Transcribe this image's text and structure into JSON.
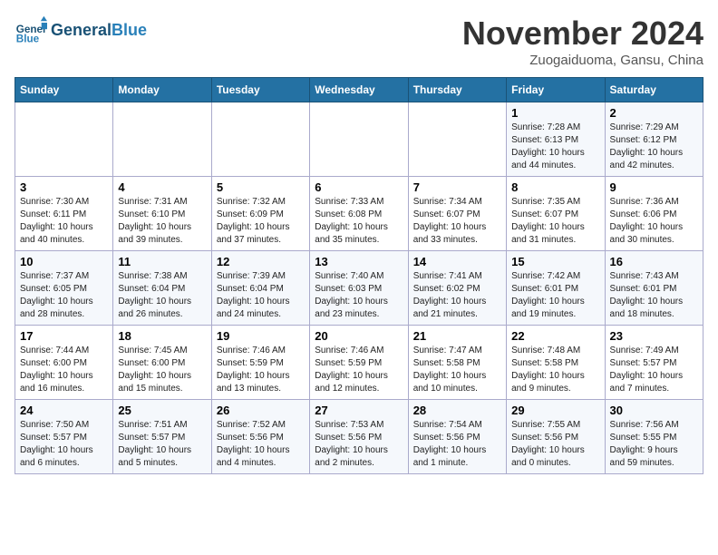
{
  "logo": {
    "line1": "General",
    "line2": "Blue"
  },
  "title": "November 2024",
  "location": "Zuogaiduoma, Gansu, China",
  "days_of_week": [
    "Sunday",
    "Monday",
    "Tuesday",
    "Wednesday",
    "Thursday",
    "Friday",
    "Saturday"
  ],
  "weeks": [
    [
      {
        "day": "",
        "info": ""
      },
      {
        "day": "",
        "info": ""
      },
      {
        "day": "",
        "info": ""
      },
      {
        "day": "",
        "info": ""
      },
      {
        "day": "",
        "info": ""
      },
      {
        "day": "1",
        "info": "Sunrise: 7:28 AM\nSunset: 6:13 PM\nDaylight: 10 hours\nand 44 minutes."
      },
      {
        "day": "2",
        "info": "Sunrise: 7:29 AM\nSunset: 6:12 PM\nDaylight: 10 hours\nand 42 minutes."
      }
    ],
    [
      {
        "day": "3",
        "info": "Sunrise: 7:30 AM\nSunset: 6:11 PM\nDaylight: 10 hours\nand 40 minutes."
      },
      {
        "day": "4",
        "info": "Sunrise: 7:31 AM\nSunset: 6:10 PM\nDaylight: 10 hours\nand 39 minutes."
      },
      {
        "day": "5",
        "info": "Sunrise: 7:32 AM\nSunset: 6:09 PM\nDaylight: 10 hours\nand 37 minutes."
      },
      {
        "day": "6",
        "info": "Sunrise: 7:33 AM\nSunset: 6:08 PM\nDaylight: 10 hours\nand 35 minutes."
      },
      {
        "day": "7",
        "info": "Sunrise: 7:34 AM\nSunset: 6:07 PM\nDaylight: 10 hours\nand 33 minutes."
      },
      {
        "day": "8",
        "info": "Sunrise: 7:35 AM\nSunset: 6:07 PM\nDaylight: 10 hours\nand 31 minutes."
      },
      {
        "day": "9",
        "info": "Sunrise: 7:36 AM\nSunset: 6:06 PM\nDaylight: 10 hours\nand 30 minutes."
      }
    ],
    [
      {
        "day": "10",
        "info": "Sunrise: 7:37 AM\nSunset: 6:05 PM\nDaylight: 10 hours\nand 28 minutes."
      },
      {
        "day": "11",
        "info": "Sunrise: 7:38 AM\nSunset: 6:04 PM\nDaylight: 10 hours\nand 26 minutes."
      },
      {
        "day": "12",
        "info": "Sunrise: 7:39 AM\nSunset: 6:04 PM\nDaylight: 10 hours\nand 24 minutes."
      },
      {
        "day": "13",
        "info": "Sunrise: 7:40 AM\nSunset: 6:03 PM\nDaylight: 10 hours\nand 23 minutes."
      },
      {
        "day": "14",
        "info": "Sunrise: 7:41 AM\nSunset: 6:02 PM\nDaylight: 10 hours\nand 21 minutes."
      },
      {
        "day": "15",
        "info": "Sunrise: 7:42 AM\nSunset: 6:01 PM\nDaylight: 10 hours\nand 19 minutes."
      },
      {
        "day": "16",
        "info": "Sunrise: 7:43 AM\nSunset: 6:01 PM\nDaylight: 10 hours\nand 18 minutes."
      }
    ],
    [
      {
        "day": "17",
        "info": "Sunrise: 7:44 AM\nSunset: 6:00 PM\nDaylight: 10 hours\nand 16 minutes."
      },
      {
        "day": "18",
        "info": "Sunrise: 7:45 AM\nSunset: 6:00 PM\nDaylight: 10 hours\nand 15 minutes."
      },
      {
        "day": "19",
        "info": "Sunrise: 7:46 AM\nSunset: 5:59 PM\nDaylight: 10 hours\nand 13 minutes."
      },
      {
        "day": "20",
        "info": "Sunrise: 7:46 AM\nSunset: 5:59 PM\nDaylight: 10 hours\nand 12 minutes."
      },
      {
        "day": "21",
        "info": "Sunrise: 7:47 AM\nSunset: 5:58 PM\nDaylight: 10 hours\nand 10 minutes."
      },
      {
        "day": "22",
        "info": "Sunrise: 7:48 AM\nSunset: 5:58 PM\nDaylight: 10 hours\nand 9 minutes."
      },
      {
        "day": "23",
        "info": "Sunrise: 7:49 AM\nSunset: 5:57 PM\nDaylight: 10 hours\nand 7 minutes."
      }
    ],
    [
      {
        "day": "24",
        "info": "Sunrise: 7:50 AM\nSunset: 5:57 PM\nDaylight: 10 hours\nand 6 minutes."
      },
      {
        "day": "25",
        "info": "Sunrise: 7:51 AM\nSunset: 5:57 PM\nDaylight: 10 hours\nand 5 minutes."
      },
      {
        "day": "26",
        "info": "Sunrise: 7:52 AM\nSunset: 5:56 PM\nDaylight: 10 hours\nand 4 minutes."
      },
      {
        "day": "27",
        "info": "Sunrise: 7:53 AM\nSunset: 5:56 PM\nDaylight: 10 hours\nand 2 minutes."
      },
      {
        "day": "28",
        "info": "Sunrise: 7:54 AM\nSunset: 5:56 PM\nDaylight: 10 hours\nand 1 minute."
      },
      {
        "day": "29",
        "info": "Sunrise: 7:55 AM\nSunset: 5:56 PM\nDaylight: 10 hours\nand 0 minutes."
      },
      {
        "day": "30",
        "info": "Sunrise: 7:56 AM\nSunset: 5:55 PM\nDaylight: 9 hours\nand 59 minutes."
      }
    ]
  ]
}
